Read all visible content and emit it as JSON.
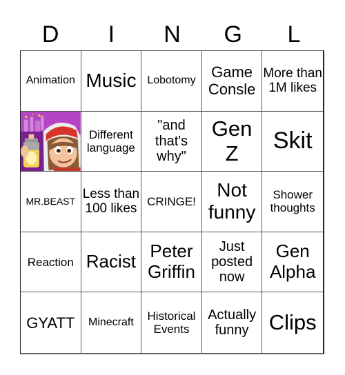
{
  "header": {
    "letters": [
      "D",
      "I",
      "N",
      "G",
      "L"
    ]
  },
  "free_cell": {
    "image": "cartoon-character-with-spray-can",
    "icon": "subway-surfers-jake-image"
  },
  "cells": [
    "Animation",
    "Music",
    "Lobotomy",
    "Game Consle",
    "More than 1M likes",
    "",
    "Different language",
    "\"and that's why\"",
    "Gen Z",
    "Skit",
    "MR.BEAST",
    "Less than 100 likes",
    "CRINGE!",
    "Not funny",
    "Shower thoughts",
    "Reaction",
    "Racist",
    "Peter Griffin",
    "Just posted now",
    "Gen Alpha",
    "GYATT",
    "Minecraft",
    "Historical Events",
    "Actually funny",
    "Clips"
  ],
  "colors": {
    "grid_line": "#555555",
    "text": "#000000",
    "background": "#ffffff",
    "image_bg": "#9b2fb5"
  }
}
